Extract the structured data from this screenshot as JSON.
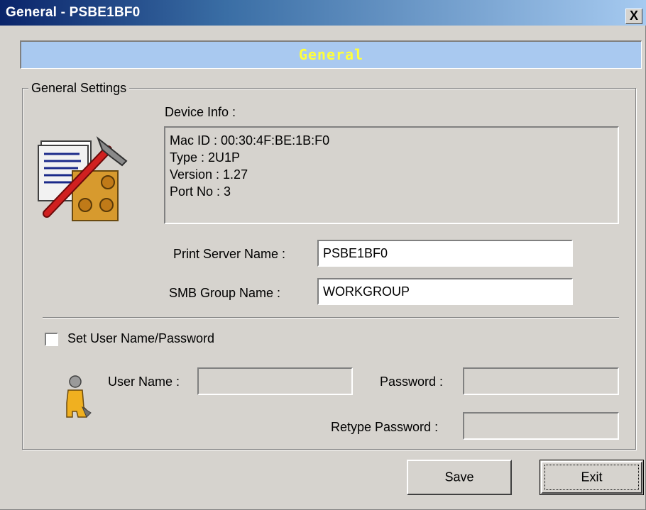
{
  "window": {
    "title": "General - PSBE1BF0",
    "close_glyph": "X"
  },
  "banner": {
    "text": "General",
    "color": "#ffff3c",
    "background": "#a9c9f0"
  },
  "group": {
    "label": "General Settings"
  },
  "device_info": {
    "label": "Device Info :",
    "lines": [
      "Mac ID : 00:30:4F:BE:1B:F0",
      "Type : 2U1P",
      "Version : 1.27",
      "Port No : 3"
    ]
  },
  "print_server": {
    "label": "Print Server Name :",
    "value": "PSBE1BF0"
  },
  "smb_group": {
    "label": "SMB  Group Name :",
    "value": "WORKGROUP"
  },
  "auth": {
    "checkbox_label": "Set User Name/Password",
    "checked": false,
    "user_label": "User Name :",
    "user_value": "",
    "password_label": "Password :",
    "password_value": "",
    "retype_label": "Retype Password :",
    "retype_value": ""
  },
  "buttons": {
    "save": "Save",
    "exit": "Exit"
  },
  "icons": {
    "settings": "tools-settings-icon",
    "user": "user-icon"
  }
}
